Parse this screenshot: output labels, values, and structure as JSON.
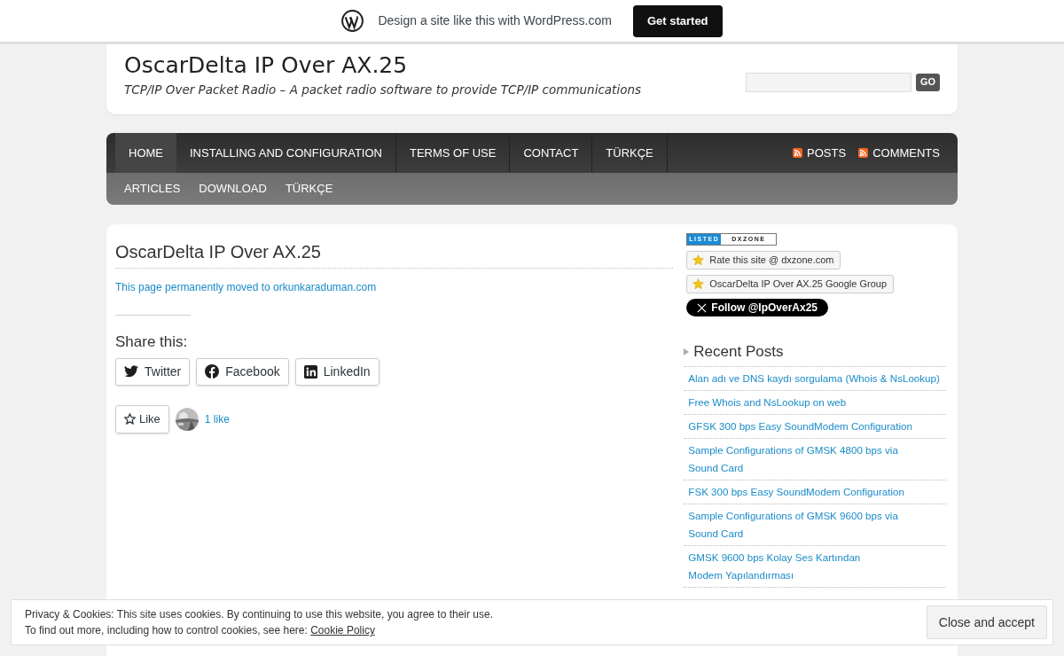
{
  "promo_bar": {
    "text": "Design a site like this with WordPress.com",
    "button": "Get started"
  },
  "header": {
    "site_title": "OscarDelta IP Over AX.25",
    "tagline": "TCP/IP Over Packet Radio – A packet radio software to provide TCP/IP communications",
    "search_button": "GO"
  },
  "nav": {
    "primary": [
      {
        "label": "HOME",
        "selected": true
      },
      {
        "label": "INSTALLING AND CONFIGURATION",
        "selected": false
      },
      {
        "label": "TERMS OF USE",
        "selected": false
      },
      {
        "label": "CONTACT",
        "selected": false
      },
      {
        "label": "TÜRKÇE",
        "selected": false
      }
    ],
    "feeds": [
      "POSTS",
      "COMMENTS"
    ],
    "secondary": [
      "ARTICLES",
      "DOWNLOAD",
      "TÜRKÇE"
    ]
  },
  "post": {
    "title": "OscarDelta IP Over AX.25",
    "body": "This page permanently moved to orkunkaraduman.com",
    "share_heading": "Share this:",
    "share_buttons": [
      {
        "kind": "twitter",
        "label": "Twitter"
      },
      {
        "kind": "facebook",
        "label": "Facebook"
      },
      {
        "kind": "linkedin",
        "label": "LinkedIn"
      }
    ],
    "like_button": "Like",
    "likes_count": "1 like"
  },
  "sidebar": {
    "badge": {
      "left": "LISTED",
      "right": "DXZONE"
    },
    "link_buttons": [
      "Rate this site @ dxzone.com",
      "OscarDelta IP Over AX.25 Google Group"
    ],
    "follow_button": "Follow @IpOverAx25",
    "recent_posts": {
      "title": "Recent Posts",
      "items": [
        {
          "lines": [
            "Alan adı ve DNS kaydı sorgulama (Whois & NsLookup)"
          ]
        },
        {
          "lines": [
            "Free Whois and NsLookup on web"
          ]
        },
        {
          "lines": [
            "GFSK 300 bps Easy SoundModem Configuration"
          ]
        },
        {
          "lines": [
            "Sample Configurations of GMSK 4800 bps via",
            "Sound Card"
          ]
        },
        {
          "lines": [
            "FSK 300 bps Easy SoundModem Configuration"
          ]
        },
        {
          "lines": [
            "Sample Configurations of GMSK 9600 bps via",
            "Sound Card"
          ]
        },
        {
          "lines": [
            "GMSK 9600 bps Kolay Ses Kartından",
            "Modem Yapılandırması"
          ]
        }
      ]
    }
  },
  "cookie_banner": {
    "line1": "Privacy & Cookies: This site uses cookies. By continuing to use this website, you agree to their use.",
    "line2": "To find out more, including how to control cookies, see here:",
    "link": "Cookie Policy",
    "button": "Close and accept"
  }
}
